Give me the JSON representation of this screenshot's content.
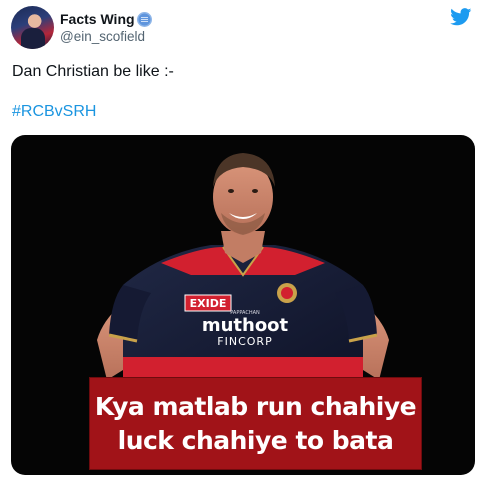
{
  "tweet": {
    "display_name": "Facts Wing",
    "handle": "@ein_scofield",
    "text": "Dan Christian be like :-",
    "hashtag": "#RCBvSRH"
  },
  "media": {
    "jersey": {
      "sponsor_left": "EXIDE",
      "brand_small": "PAPPACHAN",
      "brand_main": "muthoot",
      "brand_sub": "FINCORP"
    },
    "caption": {
      "line1": "Kya matlab run chahiye",
      "line2": "luck chahiye to bata"
    }
  },
  "colors": {
    "accent": "#1b95e0",
    "caption_bg": "#a11318",
    "jersey_red": "#d2202f",
    "jersey_navy": "#151a33",
    "gold": "#c9a24a"
  },
  "icons": [
    "verified-icon",
    "twitter-logo-icon"
  ]
}
